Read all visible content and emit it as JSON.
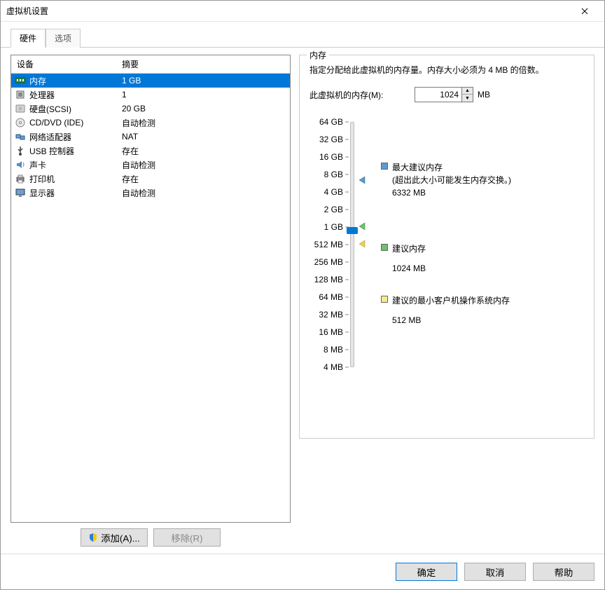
{
  "window": {
    "title": "虚拟机设置"
  },
  "tabs": {
    "hardware": "硬件",
    "options": "选项"
  },
  "list": {
    "header_device": "设备",
    "header_summary": "摘要",
    "rows": [
      {
        "label": "内存",
        "summary": "1 GB",
        "selected": true,
        "icon": "memory"
      },
      {
        "label": "处理器",
        "summary": "1",
        "selected": false,
        "icon": "cpu"
      },
      {
        "label": "硬盘(SCSI)",
        "summary": "20 GB",
        "selected": false,
        "icon": "disk"
      },
      {
        "label": "CD/DVD (IDE)",
        "summary": "自动检测",
        "selected": false,
        "icon": "cd"
      },
      {
        "label": "网络适配器",
        "summary": "NAT",
        "selected": false,
        "icon": "net"
      },
      {
        "label": "USB 控制器",
        "summary": "存在",
        "selected": false,
        "icon": "usb"
      },
      {
        "label": "声卡",
        "summary": "自动检测",
        "selected": false,
        "icon": "sound"
      },
      {
        "label": "打印机",
        "summary": "存在",
        "selected": false,
        "icon": "printer"
      },
      {
        "label": "显示器",
        "summary": "自动检测",
        "selected": false,
        "icon": "monitor"
      }
    ]
  },
  "buttons": {
    "add": "添加(A)...",
    "remove": "移除(R)"
  },
  "memory": {
    "group_title": "内存",
    "description": "指定分配给此虚拟机的内存量。内存大小必须为 4 MB 的倍数。",
    "field_label": "此虚拟机的内存(M):",
    "value": "1024",
    "unit": "MB",
    "ticks": [
      "64 GB",
      "32 GB",
      "16 GB",
      "8 GB",
      "4 GB",
      "2 GB",
      "1 GB",
      "512 MB",
      "256 MB",
      "128 MB",
      "64 MB",
      "32 MB",
      "16 MB",
      "8 MB",
      "4 MB"
    ],
    "legend": {
      "max": {
        "title": "最大建议内存",
        "note": "(超出此大小可能发生内存交换。)",
        "value": "6332 MB"
      },
      "rec": {
        "title": "建议内存",
        "value": "1024 MB"
      },
      "min": {
        "title": "建议的最小客户机操作系统内存",
        "value": "512 MB"
      }
    }
  },
  "footer": {
    "ok": "确定",
    "cancel": "取消",
    "help": "帮助"
  }
}
